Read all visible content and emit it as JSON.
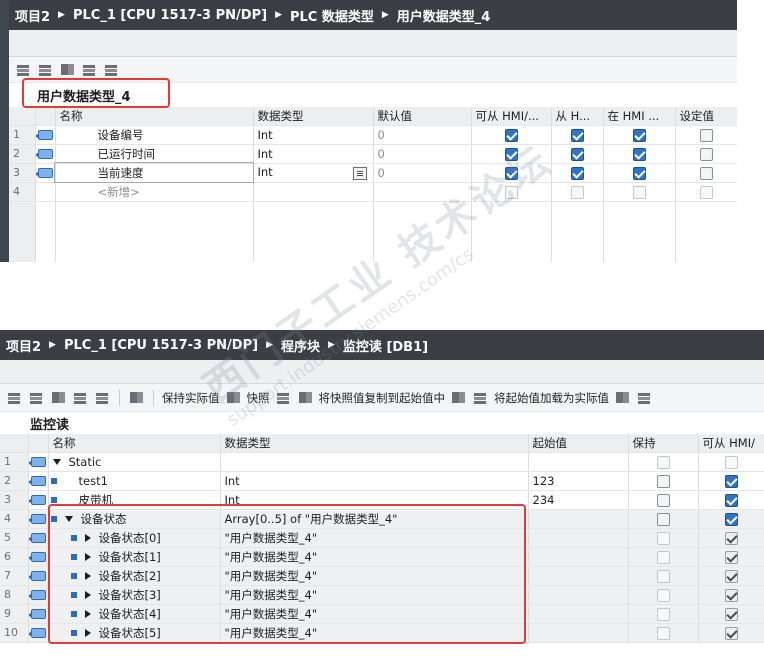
{
  "top_panel": {
    "breadcrumb": [
      "项目2",
      "PLC_1 [CPU 1517-3 PN/DP]",
      "PLC 数据类型",
      "用户数据类型_4"
    ],
    "block_name": "用户数据类型_4",
    "columns": [
      "名称",
      "数据类型",
      "默认值",
      "可从 HMI/...",
      "从 H...",
      "在 HMI ...",
      "设定值"
    ],
    "rows": [
      {
        "num": "1",
        "name": "设备编号",
        "type": "Int",
        "default": "0"
      },
      {
        "num": "2",
        "name": "已运行时间",
        "type": "Int",
        "default": "0"
      },
      {
        "num": "3",
        "name": "当前速度",
        "type": "Int",
        "default": "0"
      },
      {
        "num": "4",
        "name": "<新增>"
      }
    ]
  },
  "bottom_panel": {
    "breadcrumb": [
      "项目2",
      "PLC_1 [CPU 1517-3 PN/DP]",
      "程序块",
      "监控读 [DB1]"
    ],
    "toolbar": {
      "keep_actual": "保持实际值",
      "snapshot": "快照",
      "copy_snapshot": "将快照值复制到起始值中",
      "load_start": "将起始值加载为实际值"
    },
    "block_name": "监控读",
    "columns": [
      "名称",
      "数据类型",
      "起始值",
      "保持",
      "可从 HMI/"
    ],
    "rows": [
      {
        "num": "1",
        "name": "Static",
        "type": "",
        "start": ""
      },
      {
        "num": "2",
        "name": "test1",
        "type": "Int",
        "start": "123"
      },
      {
        "num": "3",
        "name": "皮带机",
        "type": "Int",
        "start": "234"
      },
      {
        "num": "4",
        "name": "设备状态",
        "type": "Array[0..5] of \"用户数据类型_4\"",
        "start": ""
      },
      {
        "num": "5",
        "name": "设备状态[0]",
        "type": "\"用户数据类型_4\"",
        "start": ""
      },
      {
        "num": "6",
        "name": "设备状态[1]",
        "type": "\"用户数据类型_4\"",
        "start": ""
      },
      {
        "num": "7",
        "name": "设备状态[2]",
        "type": "\"用户数据类型_4\"",
        "start": ""
      },
      {
        "num": "8",
        "name": "设备状态[3]",
        "type": "\"用户数据类型_4\"",
        "start": ""
      },
      {
        "num": "9",
        "name": "设备状态[4]",
        "type": "\"用户数据类型_4\"",
        "start": ""
      },
      {
        "num": "10",
        "name": "设备状态[5]",
        "type": "\"用户数据类型_4\"",
        "start": ""
      }
    ]
  },
  "watermark": {
    "line1": "西门子工业 技术论坛",
    "line2": "support.industry.siemens.com/cs"
  },
  "colors": {
    "highlight": "#e23b36",
    "titlebar": "#3b3f45",
    "checkbox_on": "#2f74c7"
  }
}
